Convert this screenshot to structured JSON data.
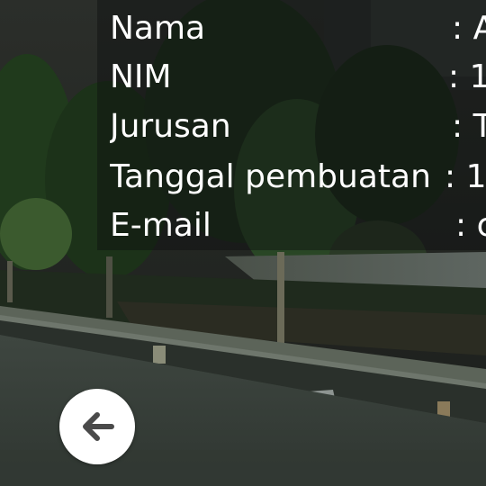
{
  "profile": {
    "rows": [
      {
        "label": "Nama",
        "separator": ": A"
      },
      {
        "label": "NIM",
        "separator": ": 1"
      },
      {
        "label": "Jurusan",
        "separator": ": T"
      },
      {
        "label": "Tanggal pembuatan",
        "separator": ": 1"
      },
      {
        "label": "E-mail",
        "separator": ": c"
      }
    ]
  },
  "back_button": {
    "icon": "arrow-left-icon",
    "icon_color": "#4a4a4a",
    "background_color": "#ffffff"
  },
  "colors": {
    "text": "#ffffff",
    "overlay": "rgba(14,16,15,0.45)"
  }
}
